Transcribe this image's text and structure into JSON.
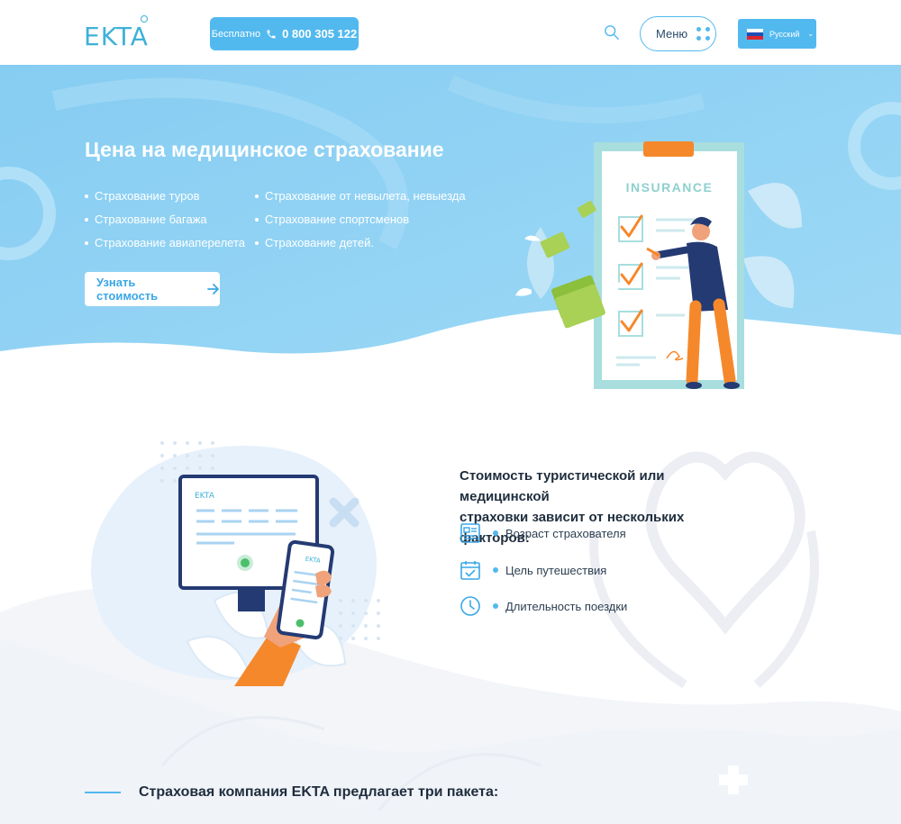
{
  "header": {
    "logo": "EKTA",
    "phone_free_label": "Бесплатно",
    "phone_number": "0 800 305 122",
    "menu_label": "Меню",
    "language_label": "Русский"
  },
  "hero": {
    "title": "Цена на медицинское страхование",
    "list_col1": [
      "Страхование туров",
      "Страхование багажа",
      "Страхование авиаперелета"
    ],
    "list_col2": [
      "Страхование от невылета, невыезда",
      "Страхование спортсменов",
      "Страхование детей."
    ],
    "cta_label": "Узнать стоимость",
    "illustration_text": "INSURANCE",
    "screen_logo": "EKTA"
  },
  "factors": {
    "title_line1": "Стоимость туристической или медицинской",
    "title_line2": "страховки зависит от нескольких факторов:",
    "items": [
      {
        "label": "Возраст страхователя",
        "icon": "id-card-icon"
      },
      {
        "label": "Цель путешествия",
        "icon": "calendar-check-icon"
      },
      {
        "label": "Длительность поездки",
        "icon": "clock-icon"
      }
    ]
  },
  "packages": {
    "title": "Страховая компания EKTA предлагает три пакета:"
  },
  "colors": {
    "accent": "#52b9ef",
    "hero_bg": "#8fd0f3",
    "orange": "#f5882b",
    "navy": "#243a73"
  }
}
